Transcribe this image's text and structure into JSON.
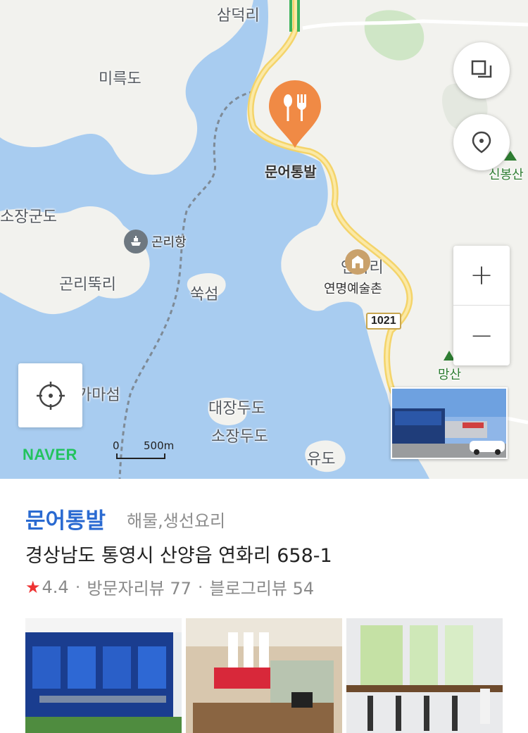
{
  "map": {
    "labels": {
      "samdeok": "삼덕리",
      "mireuk": "미륵도",
      "munaotongbal": "문어통발",
      "sojanggun": "소장군도",
      "gonri_port": "곤리항",
      "gonri_ddeok": "곤리뚝리",
      "suk": "쑥섬",
      "yeonhwari": "연화리",
      "yeonmyeong": "연명예술촌",
      "road": "1021",
      "singbong": "신봉산",
      "mangsan": "망산",
      "gamaseom": "가마섬",
      "daejangdu": "대장두도",
      "sojangdu": "소장두도",
      "yudo": "유도"
    },
    "logo": "NAVER",
    "scale": {
      "zero": "0",
      "distance": "500m"
    },
    "controls": {
      "zoom_in": "+",
      "zoom_out": "−"
    }
  },
  "place": {
    "name": "문어통발",
    "category": "해물,생선요리",
    "address": "경상남도 통영시 산양읍 연화리 658-1",
    "rating": "4.4",
    "separator": "·",
    "visitor_reviews": "방문자리뷰 77",
    "blog_reviews": "블로그리뷰 54"
  },
  "colors": {
    "sea": "#a8ccf0",
    "land": "#f2f2ee",
    "pin": "#f08a45",
    "name_blue": "#2a6ad1",
    "naver_green": "#22c35e",
    "star": "#e33333"
  }
}
